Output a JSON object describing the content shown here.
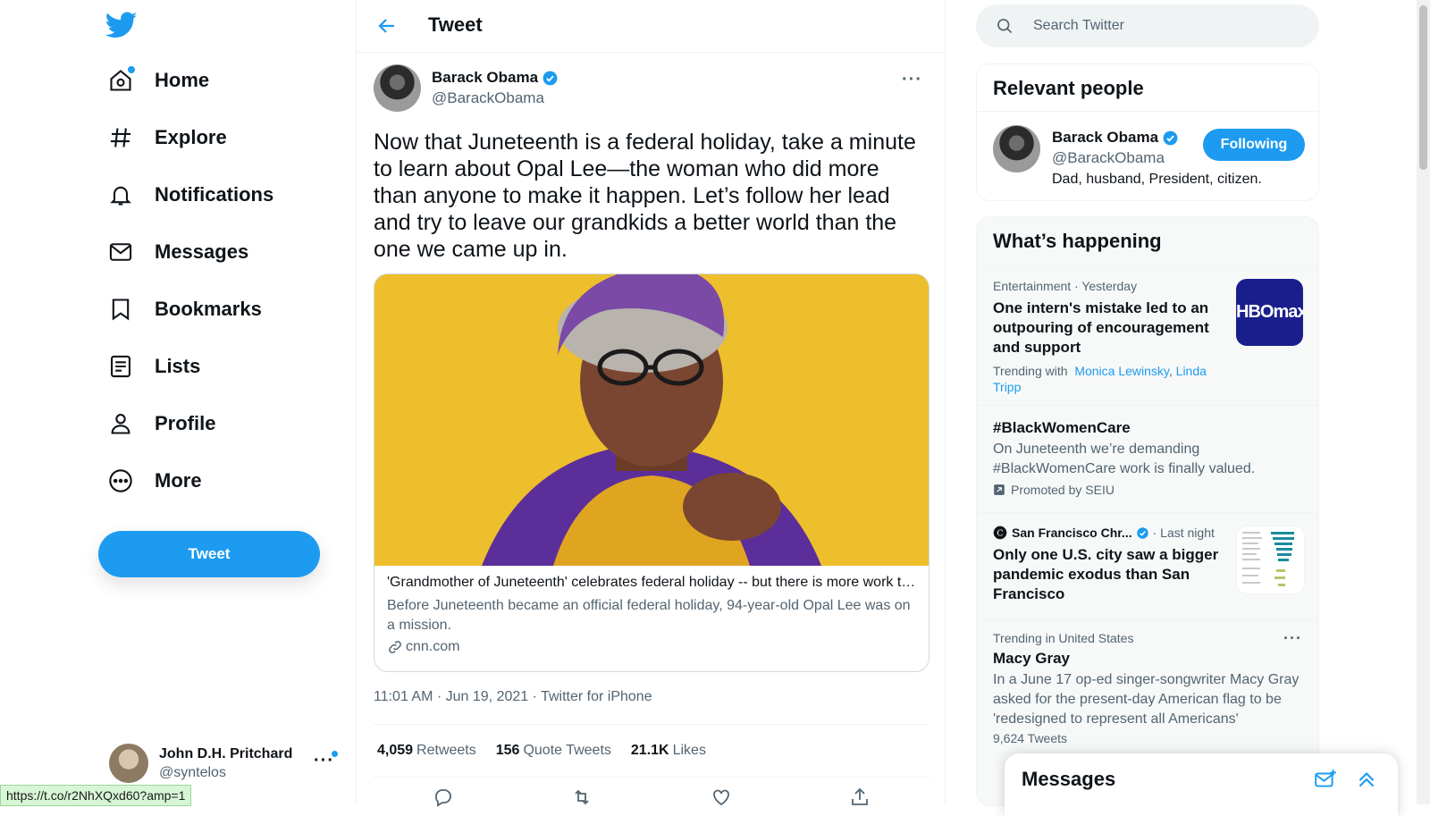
{
  "sidebar": {
    "nav": [
      {
        "label": "Home",
        "icon": "home-icon"
      },
      {
        "label": "Explore",
        "icon": "hashtag-icon"
      },
      {
        "label": "Notifications",
        "icon": "bell-icon"
      },
      {
        "label": "Messages",
        "icon": "envelope-icon"
      },
      {
        "label": "Bookmarks",
        "icon": "bookmark-icon"
      },
      {
        "label": "Lists",
        "icon": "list-icon"
      },
      {
        "label": "Profile",
        "icon": "person-icon"
      },
      {
        "label": "More",
        "icon": "more-circle-icon"
      }
    ],
    "tweet_button": "Tweet",
    "account": {
      "name": "John D.H. Pritchard",
      "handle": "@syntelos",
      "more": "···"
    }
  },
  "status_url": "https://t.co/r2NhXQxd60?amp=1",
  "main": {
    "header_title": "Tweet",
    "tweet": {
      "author_name": "Barack Obama",
      "author_handle": "@BarackObama",
      "more": "···",
      "text": "Now that Juneteenth is a federal holiday, take a minute to learn about Opal Lee—the woman who did more than anyone to make it happen. Let’s follow her lead and try to leave our grandkids a better world than the one we came up in.",
      "card": {
        "title": "'Grandmother of Juneteenth' celebrates federal holiday -- but there is more work to do",
        "description": "Before Juneteenth became an official federal holiday, 94-year-old Opal Lee was on a mission.",
        "domain": "cnn.com"
      },
      "timestamp": "11:01 AM · Jun 19, 2021 · Twitter for iPhone",
      "stats": {
        "retweets_count": "4,059",
        "retweets_label": "Retweets",
        "quotes_count": "156",
        "quotes_label": "Quote Tweets",
        "likes_count": "21.1K",
        "likes_label": "Likes"
      }
    }
  },
  "right": {
    "search_placeholder": "Search Twitter",
    "relevant": {
      "title": "Relevant people",
      "person": {
        "name": "Barack Obama",
        "handle": "@BarackObama",
        "bio": "Dad, husband, President, citizen.",
        "button": "Following"
      }
    },
    "happening": {
      "title": "What’s happening",
      "trends": [
        {
          "context": "Entertainment · Yesterday",
          "headline": "One intern's mistake led to an outpouring of encouragement and support",
          "trending_with": "Trending with",
          "link1": "Monica Lewinsky",
          "sep": ", ",
          "link2": "Linda Tripp",
          "thumb_text": "HBOmax"
        },
        {
          "title": "#BlackWomenCare",
          "body": "On Juneteenth we’re demanding #BlackWomenCare work is finally valued.",
          "promoted": "Promoted by SEIU"
        },
        {
          "source": "San Francisco Chr...",
          "time": "· Last night",
          "headline": "Only one U.S. city saw a bigger pandemic exodus than San Francisco"
        },
        {
          "context": "Trending in United States",
          "title": "Macy Gray",
          "body": "In a June 17 op-ed singer-songwriter Macy Gray asked for the present-day American flag to be 'redesigned to represent all Americans'",
          "count": "9,624 Tweets",
          "more": "···"
        }
      ]
    },
    "messages_drawer": {
      "title": "Messages"
    }
  },
  "colors": {
    "accent": "#1d9bf0",
    "text": "#0f1419",
    "muted": "#536471",
    "border": "#eff3f4"
  }
}
